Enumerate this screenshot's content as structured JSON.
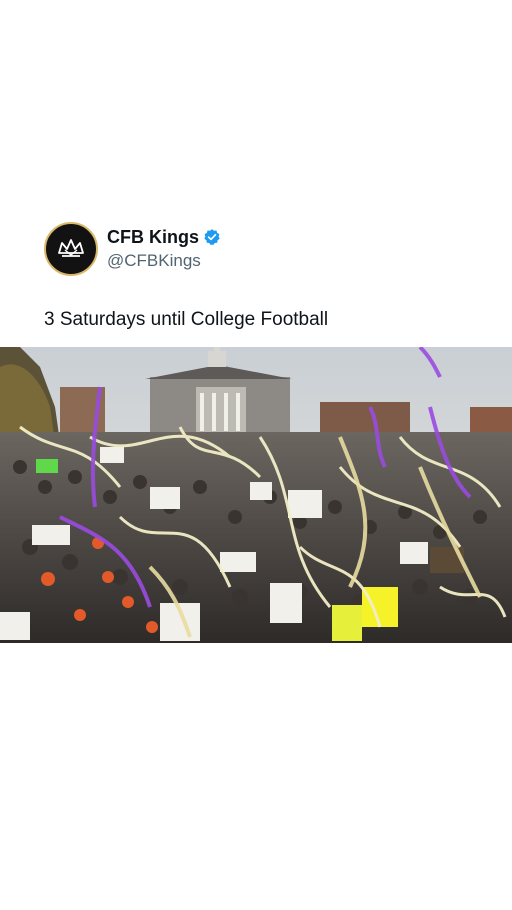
{
  "tweet": {
    "display_name": "CFB Kings",
    "handle": "@CFBKings",
    "verified": true,
    "text": "3 Saturdays until College Football"
  },
  "avatar": {
    "icon": "crown-logo-icon",
    "background": "#121212",
    "accent": "#d9b86a"
  },
  "media": {
    "type": "video-frame",
    "description_icon": "stadium-crowd-confetti-image"
  },
  "colors": {
    "verified_badge": "#1d9bf0",
    "text_primary": "#0f1419",
    "text_secondary": "#536471"
  }
}
